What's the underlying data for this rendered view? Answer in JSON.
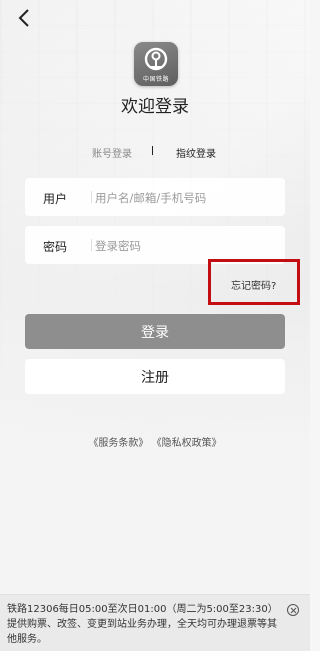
{
  "app": {
    "logo_text": "中国铁路",
    "title": "欢迎登录"
  },
  "login_tabs": {
    "account": "账号登录",
    "fingerprint": "指纹登录"
  },
  "form": {
    "user_label": "用户",
    "user_placeholder": "用户名/邮箱/手机号码",
    "password_label": "密码",
    "password_placeholder": "登录密码",
    "forgot_password": "忘记密码?"
  },
  "buttons": {
    "login": "登录",
    "register": "注册"
  },
  "policy": {
    "terms": "《服务条款》",
    "privacy": "《隐私权政策》"
  },
  "notice": {
    "text": "铁路12306每日05:00至次日01:00（周二为5:00至23:30）提供购票、改签、变更到站业务办理，全天均可办理退票等其他服务。"
  },
  "colors": {
    "highlight": "#c20d12",
    "login_button": "#8e8e8e"
  },
  "icons": {
    "back": "chevron-left-icon",
    "close": "close-circle-icon",
    "logo": "china-railway-logo"
  }
}
